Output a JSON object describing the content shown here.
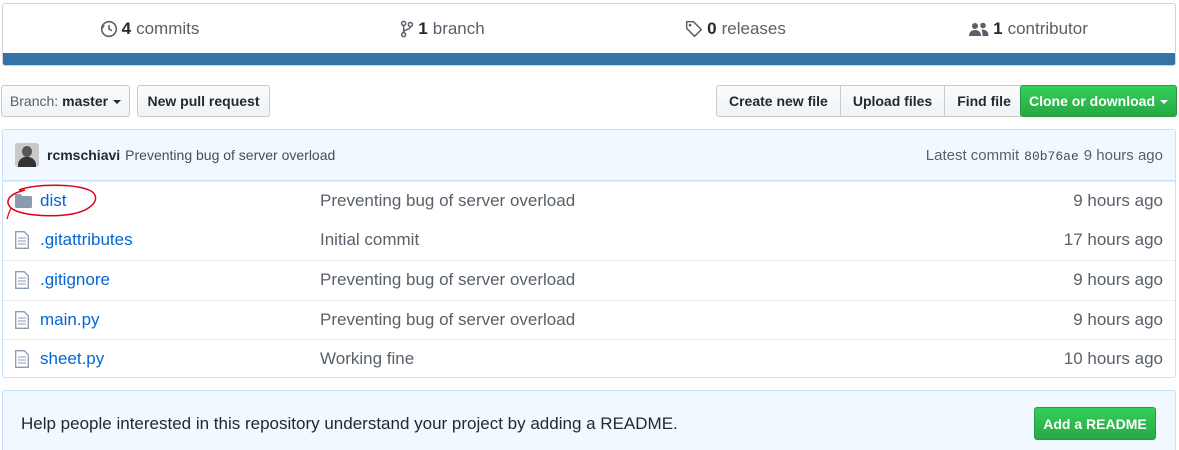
{
  "summary": {
    "commits": {
      "count": "4",
      "label": "commits",
      "icon": "history-icon"
    },
    "branch": {
      "count": "1",
      "label": "branch",
      "icon": "git-branch-icon"
    },
    "releases": {
      "count": "0",
      "label": "releases",
      "icon": "tag-icon"
    },
    "contributors": {
      "count": "1",
      "label": "contributor",
      "icon": "people-icon"
    },
    "language_color": "#3572a5"
  },
  "toolbar": {
    "branch_prefix": "Branch:",
    "branch_name": "master",
    "new_pull_request": "New pull request",
    "create_new_file": "Create new file",
    "upload_files": "Upload files",
    "find_file": "Find file",
    "clone_or_download": "Clone or download"
  },
  "latest_commit": {
    "author": "rcmschiavi",
    "message": "Preventing bug of server overload",
    "label": "Latest commit",
    "sha": "80b76ae",
    "age": "9 hours ago"
  },
  "files": [
    {
      "name": "dist",
      "type": "folder",
      "message": "Preventing bug of server overload",
      "age": "9 hours ago"
    },
    {
      "name": ".gitattributes",
      "type": "file",
      "message": "Initial commit",
      "age": "17 hours ago"
    },
    {
      "name": ".gitignore",
      "type": "file",
      "message": "Preventing bug of server overload",
      "age": "9 hours ago"
    },
    {
      "name": "main.py",
      "type": "file",
      "message": "Preventing bug of server overload",
      "age": "9 hours ago"
    },
    {
      "name": "sheet.py",
      "type": "file",
      "message": "Working fine",
      "age": "10 hours ago"
    }
  ],
  "readme_prompt": {
    "text": "Help people interested in this repository understand your project by adding a README.",
    "button": "Add a README"
  },
  "colors": {
    "link": "#0366d6",
    "primary_button": "#28a745",
    "annotation": "#e0001a"
  }
}
